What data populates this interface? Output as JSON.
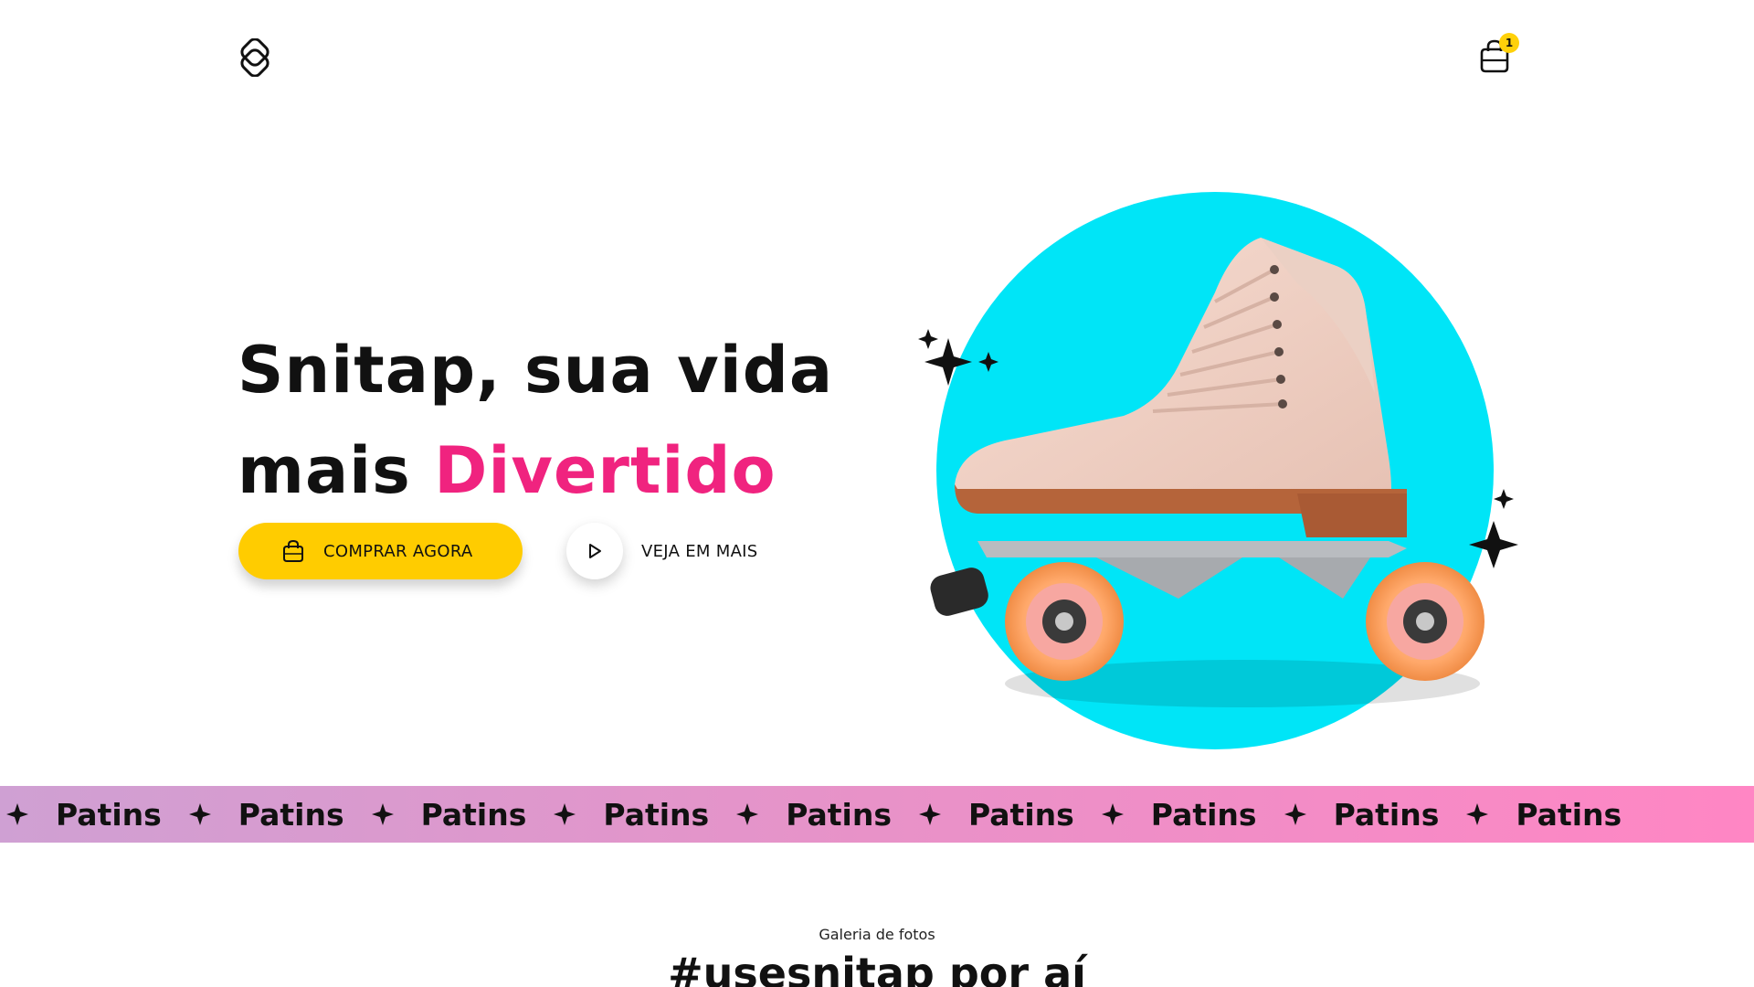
{
  "header": {
    "logo_icon": "snitap-logo-icon",
    "cart_icon": "shopping-bag-icon",
    "cart_count": "1",
    "badge_color": "#FFD10A"
  },
  "hero": {
    "title_line1": "Snitap, sua vida",
    "title_line2_plain": "mais ",
    "title_line2_accent": "Divertido",
    "accent_color": "#F0237F",
    "buy_button": {
      "label": "COMPRAR AGORA",
      "icon": "shopping-bag-icon",
      "color": "#FFCC00"
    },
    "more_button": {
      "label": "VEJA EM MAIS",
      "icon": "play-icon"
    },
    "image": {
      "icon": "roller-skate-image",
      "circle_color": "#00E5F7"
    }
  },
  "marquee": {
    "word": "Patins",
    "separator_icon": "sparkle-star-icon",
    "items": [
      "Patins",
      "Patins",
      "Patins",
      "Patins",
      "Patins",
      "Patins",
      "Patins",
      "Patins",
      "Patins"
    ]
  },
  "gallery": {
    "kicker": "Galeria de fotos",
    "title": "#usesnitap por aí"
  }
}
